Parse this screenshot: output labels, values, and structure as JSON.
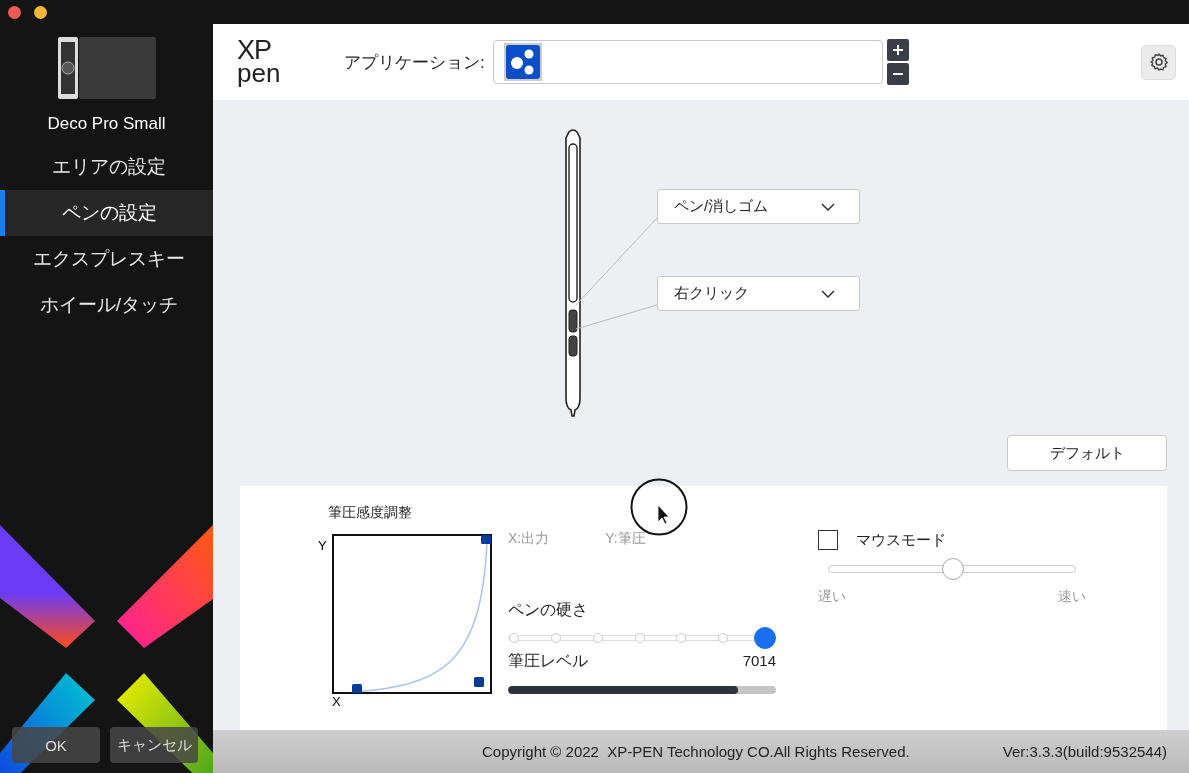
{
  "sidebar": {
    "device_name": "Deco Pro Small",
    "items": [
      {
        "label": "エリアの設定",
        "selected": false
      },
      {
        "label": "ペンの設定",
        "selected": true
      },
      {
        "label": "エクスプレスキー",
        "selected": false
      },
      {
        "label": "ホイール/タッチ",
        "selected": false
      }
    ],
    "buttons": [
      "OK",
      "キャンセル"
    ]
  },
  "header": {
    "logo_top": "XP",
    "logo_bottom": "pen",
    "application_label": "アプリケーション:"
  },
  "pen": {
    "buttons": [
      {
        "label": "ペン/消しゴム"
      },
      {
        "label": "右クリック"
      }
    ]
  },
  "default_button": "デフォルト",
  "pressure": {
    "title": "筆圧感度調整",
    "x_axis": "X",
    "y_axis": "Y",
    "x_legend": "X:出力",
    "y_legend": "Y:筆圧"
  },
  "hardness": {
    "label": "ペンの硬さ",
    "stops": [
      {
        "selected": false
      },
      {
        "selected": false
      },
      {
        "selected": false
      },
      {
        "selected": false
      },
      {
        "selected": false
      },
      {
        "selected": false
      },
      {
        "selected": true
      }
    ]
  },
  "pressure_level": {
    "label": "筆圧レベル",
    "reading": "7014",
    "level": 0.86
  },
  "mouse_mode": {
    "label": "マウスモード",
    "checked": false,
    "speed": {
      "level": 0.5,
      "min_label": "遅い",
      "max_label": "速い"
    }
  },
  "footer": {
    "copyright": "Copyright © 2022  XP-PEN Technology CO.All Rights Reserved.",
    "version": "Ver:3.3.3(build:9532544)"
  }
}
